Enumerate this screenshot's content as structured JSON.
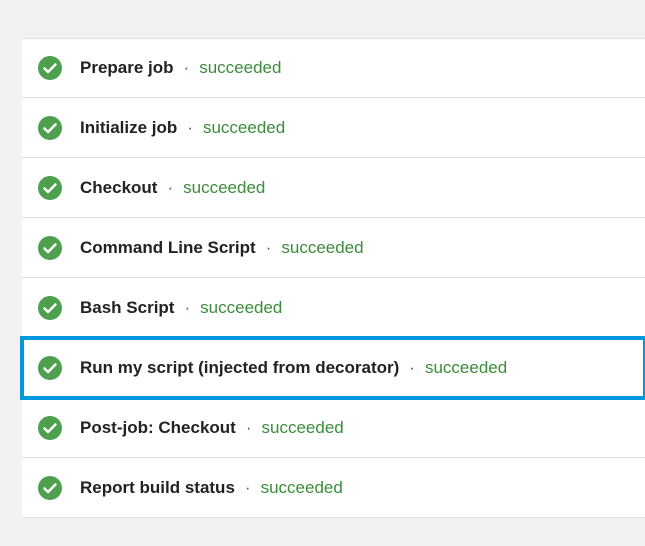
{
  "steps": [
    {
      "name": "Prepare job",
      "status": "succeeded",
      "highlighted": false
    },
    {
      "name": "Initialize job",
      "status": "succeeded",
      "highlighted": false
    },
    {
      "name": "Checkout",
      "status": "succeeded",
      "highlighted": false
    },
    {
      "name": "Command Line Script",
      "status": "succeeded",
      "highlighted": false
    },
    {
      "name": "Bash Script",
      "status": "succeeded",
      "highlighted": false
    },
    {
      "name": "Run my script (injected from decorator)",
      "status": "succeeded",
      "highlighted": true
    },
    {
      "name": "Post-job: Checkout",
      "status": "succeeded",
      "highlighted": false
    },
    {
      "name": "Report build status",
      "status": "succeeded",
      "highlighted": false
    }
  ],
  "separator": "·",
  "colors": {
    "success_icon": "#4ea04e",
    "success_text": "#3b8c3b",
    "highlight_border": "#0099e0"
  }
}
